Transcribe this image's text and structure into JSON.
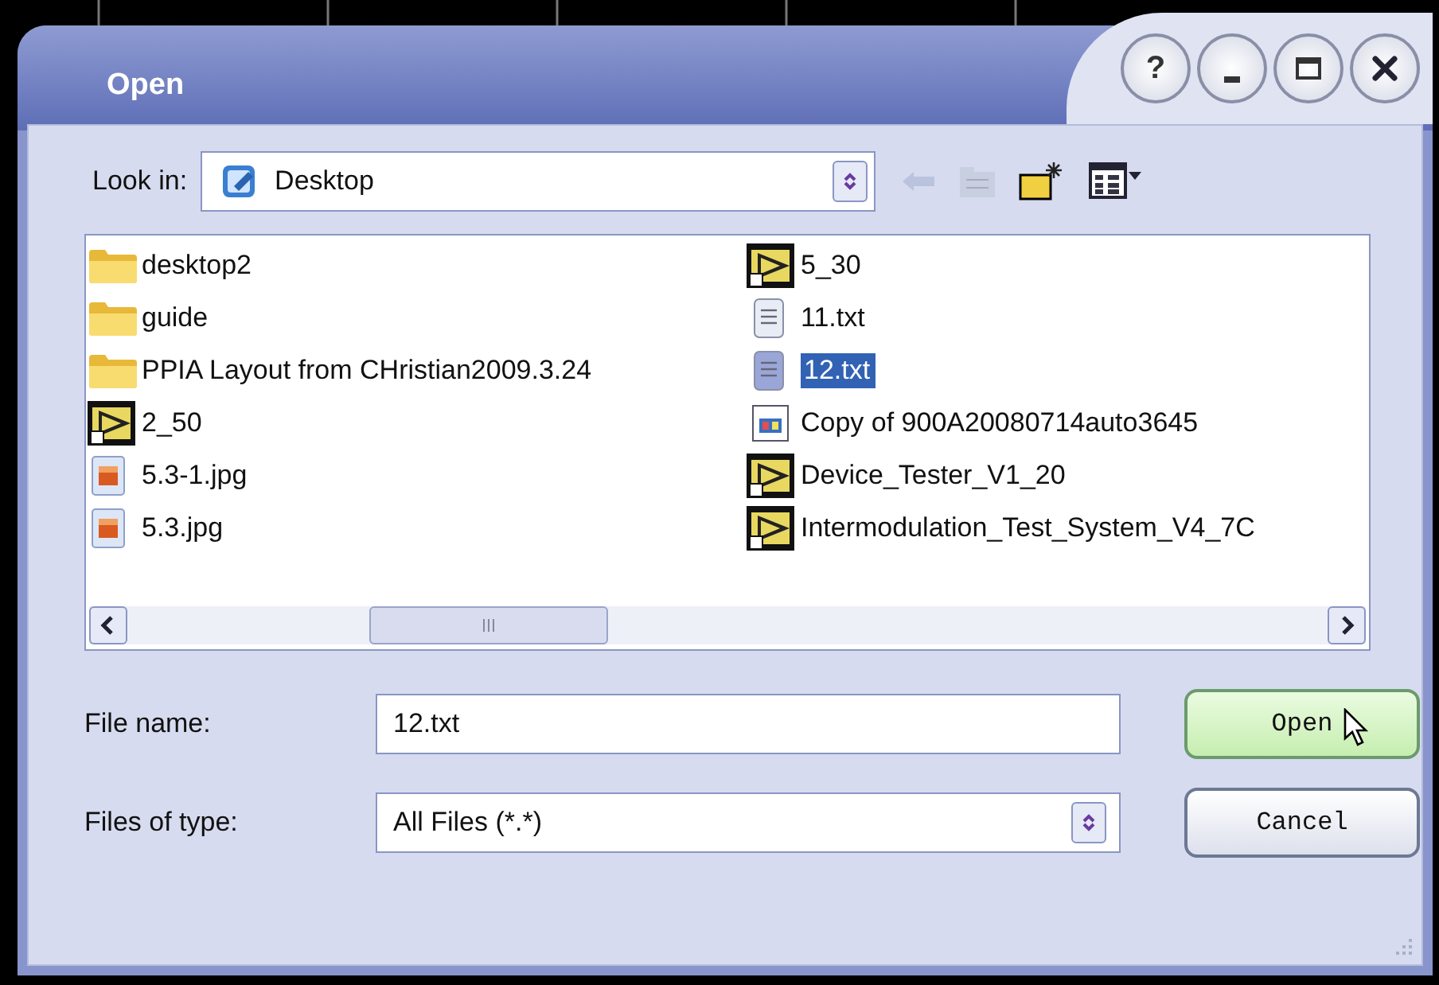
{
  "window": {
    "title": "Open"
  },
  "caption_buttons": [
    {
      "kind": "help",
      "glyph": "?"
    },
    {
      "kind": "minimize"
    },
    {
      "kind": "maximize"
    },
    {
      "kind": "close"
    }
  ],
  "look_in": {
    "label": "Look in:",
    "value": "Desktop"
  },
  "files": [
    {
      "name": "desktop2",
      "kind": "folder",
      "selected": false
    },
    {
      "name": "guide",
      "kind": "folder",
      "selected": false
    },
    {
      "name": "PPIA Layout from CHristian2009.3.24",
      "kind": "folder",
      "selected": false
    },
    {
      "name": "2_50",
      "kind": "vi",
      "selected": false
    },
    {
      "name": "5.3-1.jpg",
      "kind": "image",
      "selected": false
    },
    {
      "name": "5.3.jpg",
      "kind": "image",
      "selected": false
    },
    {
      "name": "5_30",
      "kind": "vi",
      "selected": false
    },
    {
      "name": "11.txt",
      "kind": "text",
      "selected": false
    },
    {
      "name": "12.txt",
      "kind": "text",
      "selected": true
    },
    {
      "name": "Copy of 900A20080714auto3645",
      "kind": "web",
      "selected": false
    },
    {
      "name": "Device_Tester_V1_20",
      "kind": "vi",
      "selected": false
    },
    {
      "name": "Intermodulation_Test_System_V4_7C",
      "kind": "vi",
      "selected": false
    }
  ],
  "file_name": {
    "label": "File name:",
    "value": "12.txt"
  },
  "file_type": {
    "label": "Files of type:",
    "value": "All Files (*.*)"
  },
  "buttons": [
    {
      "label": "Open",
      "kind": "default"
    },
    {
      "label": "Cancel",
      "kind": "normal"
    }
  ]
}
